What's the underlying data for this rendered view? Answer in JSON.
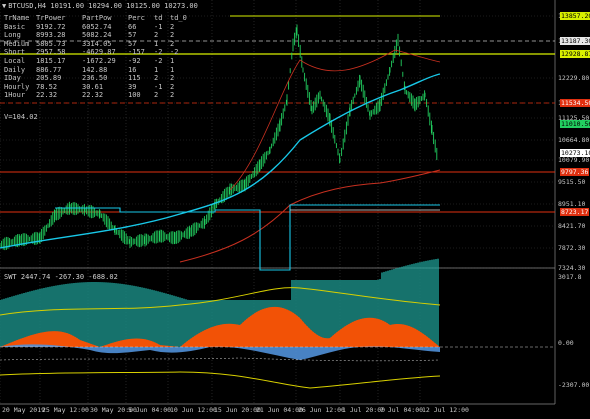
{
  "header": {
    "symbol_line": "BTCUSD,H4  10191.00 10294.00 10125.00 10273.00"
  },
  "table": {
    "columns": [
      "TrName",
      "TrPower",
      "PartPow",
      "Perc",
      "td",
      "td_0"
    ],
    "rows": [
      [
        "Basic",
        "9192.72",
        "6052.74",
        "66",
        "-1",
        "2"
      ],
      [
        "Long",
        "8993.28",
        "5082.24",
        "57",
        "2",
        "2"
      ],
      [
        "Medium",
        "5805.73",
        "3314.05",
        "57",
        "1",
        "2"
      ],
      [
        "Short",
        "2957.58",
        "-4629.87",
        "-157",
        "-2",
        "-2"
      ],
      [
        "Local",
        "1815.17",
        "-1672.29",
        "-92",
        "-2",
        "1"
      ],
      [
        "Daily",
        "886.77",
        "142.88",
        "16",
        "1",
        "1"
      ],
      [
        "IDay",
        "205.89",
        "236.50",
        "115",
        "2",
        "2"
      ],
      [
        "Hourly",
        "78.52",
        "30.61",
        "39",
        "-1",
        "2"
      ],
      [
        "1Hour",
        "22.32",
        "22.32",
        "100",
        "2",
        "2"
      ]
    ],
    "v_line": "V=104.02"
  },
  "swt_label": "SWT 2447.74 -267.30 -688.02",
  "price_labels": [
    "13857.20",
    "13187.30",
    "12229.80",
    "11534.50",
    "11125.50",
    "10664.80",
    "10079.90",
    "9515.50",
    "8951.10",
    "8421.70",
    "7872.30",
    "7324.30"
  ],
  "price_boxes": [
    {
      "text": "13857.20",
      "fg": "#000000",
      "bg": "#d8f000"
    },
    {
      "text": "13187.30",
      "fg": "#000000",
      "bg": "#e8e8e8"
    },
    {
      "text": "12928.87",
      "fg": "#000000",
      "bg": "#d8f000"
    },
    {
      "text": "11534.50",
      "fg": "#ffffff",
      "bg": "#e03010"
    },
    {
      "text": "11010.56",
      "fg": "#000000",
      "bg": "#22d060"
    },
    {
      "text": "10273.10",
      "fg": "#000000",
      "bg": "#ffffff"
    },
    {
      "text": "9797.36",
      "fg": "#ffffff",
      "bg": "#e03010"
    },
    {
      "text": "8723.17",
      "fg": "#ffffff",
      "bg": "#e03010"
    }
  ],
  "sub_labels": [
    "3017.8",
    "0.00",
    "-2307.00"
  ],
  "time_labels": [
    "20 May 2019",
    "25 May 12:00",
    "30 May 20:00",
    "5 Jun 04:00",
    "10 Jun 12:00",
    "15 Jun 20:00",
    "21 Jun 04:00",
    "26 Jun 12:00",
    "1 Jul 20:00",
    "7 Jul 04:00",
    "12 Jul 12:00"
  ],
  "colors": {
    "candles": "#22d060",
    "price_line": "#18c8e8",
    "ma_red": "#c83020",
    "hline_yellow": "#d8f000",
    "hline_red": "#e03010",
    "hist_teal": "#20a8a0",
    "hist_orange": "#ff5000",
    "hist_blue": "#5090d8",
    "band_yellow": "#d8d000"
  }
}
